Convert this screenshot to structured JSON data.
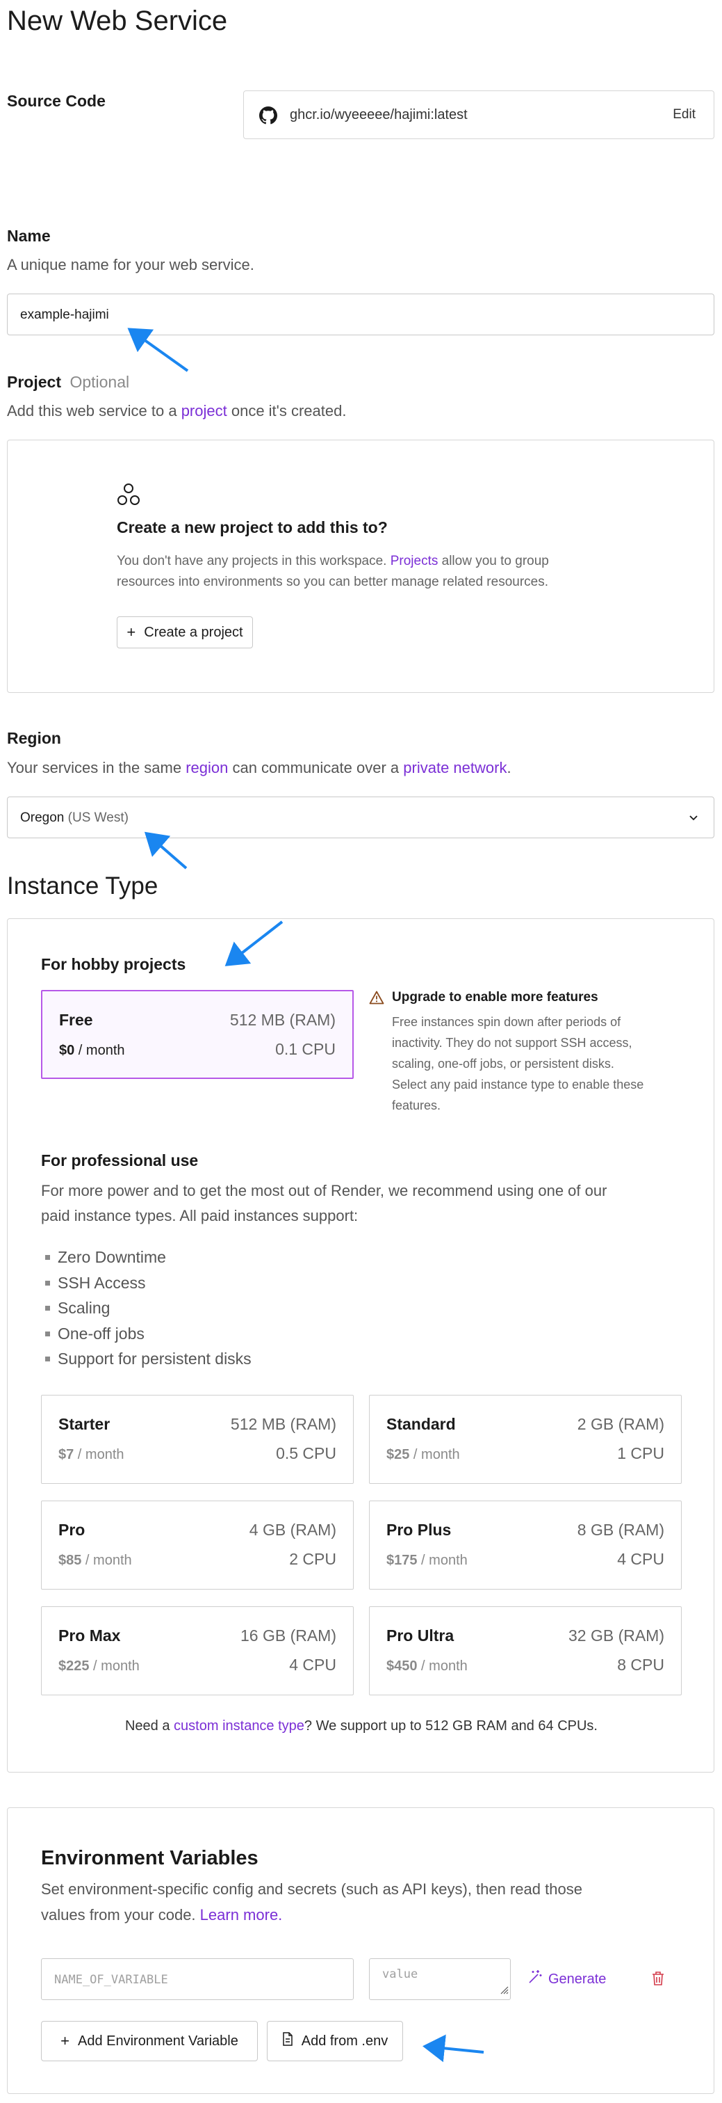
{
  "page": {
    "title": "New Web Service"
  },
  "source_code": {
    "label": "Source Code",
    "image": "ghcr.io/wyeeeee/hajimi:latest",
    "edit": "Edit",
    "icon": "github-icon"
  },
  "name": {
    "label": "Name",
    "description": "A unique name for your web service.",
    "value": "example-hajimi"
  },
  "project": {
    "label": "Project",
    "optional": "Optional",
    "desc_pre": "Add this web service to a ",
    "desc_link": "project",
    "desc_post": " once it's created.",
    "empty_title": "Create a new project to add this to?",
    "empty_pre": "You don't have any projects in this workspace. ",
    "empty_link": "Projects",
    "empty_post1": " allow you to group",
    "empty_line2": "resources into environments so you can better manage related resources.",
    "create_button": "Create a project"
  },
  "region": {
    "label": "Region",
    "desc_pre": "Your services in the same ",
    "desc_link1": "region",
    "desc_mid": " can communicate over a ",
    "desc_link2": "private network",
    "desc_post": ".",
    "selected": "Oregon",
    "selected_detail": "(US West)"
  },
  "instance_type": {
    "title": "Instance Type",
    "hobby_heading": "For hobby projects",
    "free": {
      "name": "Free",
      "ram": "512 MB (RAM)",
      "price": "$0",
      "per": " / month",
      "cpu": "0.1 CPU"
    },
    "upgrade_title": "Upgrade to enable more features",
    "upgrade_lines": [
      "Free instances spin down after periods of",
      "inactivity. They do not support SSH access,",
      "scaling, one-off jobs, or persistent disks.",
      "Select any paid instance type to enable these",
      "features."
    ],
    "pro_heading": "For professional use",
    "pro_desc1": "For more power and to get the most out of Render, we recommend using one of our",
    "pro_desc2": "paid instance types. All paid instances support:",
    "features": [
      "Zero Downtime",
      "SSH Access",
      "Scaling",
      "One-off jobs",
      "Support for persistent disks"
    ],
    "plans": [
      {
        "name": "Starter",
        "ram": "512 MB (RAM)",
        "price": "$7",
        "per": " / month",
        "cpu": "0.5 CPU"
      },
      {
        "name": "Standard",
        "ram": "2 GB (RAM)",
        "price": "$25",
        "per": " / month",
        "cpu": "1 CPU"
      },
      {
        "name": "Pro",
        "ram": "4 GB (RAM)",
        "price": "$85",
        "per": " / month",
        "cpu": "2 CPU"
      },
      {
        "name": "Pro Plus",
        "ram": "8 GB (RAM)",
        "price": "$175",
        "per": " / month",
        "cpu": "4 CPU"
      },
      {
        "name": "Pro Max",
        "ram": "16 GB (RAM)",
        "price": "$225",
        "per": " / month",
        "cpu": "4 CPU"
      },
      {
        "name": "Pro Ultra",
        "ram": "32 GB (RAM)",
        "price": "$450",
        "per": " / month",
        "cpu": "8 CPU"
      }
    ],
    "custom_pre": "Need a ",
    "custom_link": "custom instance type",
    "custom_post": "? We support up to 512 GB RAM and 64 CPUs."
  },
  "env": {
    "title": "Environment Variables",
    "desc1": "Set environment-specific config and secrets (such as API keys), then read those",
    "desc2_pre": "values from your code. ",
    "desc2_link": "Learn more.",
    "key_placeholder": "NAME_OF_VARIABLE",
    "value_placeholder": "value",
    "generate": "Generate",
    "add_button": "Add Environment Variable",
    "add_from_env": "Add from .env"
  },
  "colors": {
    "accent": "#7b2fd6",
    "selected_border": "#b659e8",
    "annotation_arrow": "#1a86f0",
    "warning": "#8a4b1e",
    "delete": "#d33a4a"
  }
}
